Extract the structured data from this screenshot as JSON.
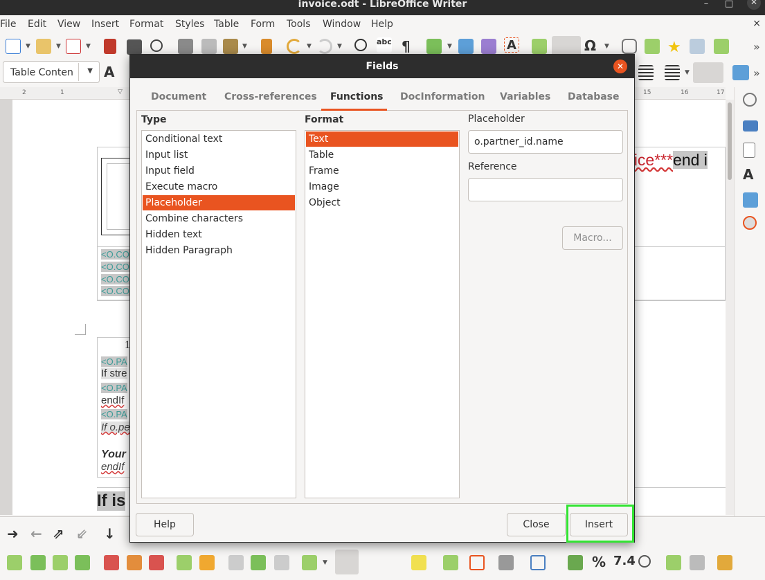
{
  "window": {
    "title": "invoice.odt - LibreOffice Writer"
  },
  "menubar": {
    "items": [
      "File",
      "Edit",
      "View",
      "Insert",
      "Format",
      "Styles",
      "Table",
      "Form",
      "Tools",
      "Window",
      "Help"
    ],
    "close_glyph": "×"
  },
  "toolbar": {
    "paragraph_style": "Table Conten",
    "more_glyph": "»"
  },
  "ruler": {
    "ticks": [
      "2",
      "1",
      "15",
      "16",
      "17"
    ]
  },
  "document": {
    "fragments": {
      "fld1": "<O.CO",
      "fld2": "<O.CO",
      "fld3": "<O.CO",
      "fld4": "<O.CO",
      "num": "1",
      "fld5": "<O.PA",
      "if_stre": "If stre",
      "fld6": "<O.PA",
      "endif1": "endIf",
      "fld7": "<O.PA",
      "if_o": "If o.pe",
      "your": "Your",
      "endif2": "endIf",
      "if_is": "If is",
      "invoice": "oice***",
      "end_if": "end i"
    }
  },
  "dialog": {
    "title": "Fields",
    "tabs": [
      "Document",
      "Cross-references",
      "Functions",
      "DocInformation",
      "Variables",
      "Database"
    ],
    "active_tab": "Functions",
    "type_label": "Type",
    "type_items": [
      "Conditional text",
      "Input list",
      "Input field",
      "Execute macro",
      "Placeholder",
      "Combine characters",
      "Hidden text",
      "Hidden Paragraph"
    ],
    "type_selected": "Placeholder",
    "format_label": "Format",
    "format_items": [
      "Text",
      "Table",
      "Frame",
      "Image",
      "Object"
    ],
    "format_selected": "Text",
    "placeholder_label": "Placeholder",
    "placeholder_value": "o.partner_id.name",
    "reference_label": "Reference",
    "reference_value": "",
    "macro_button": "Macro...",
    "help_button": "Help",
    "close_button": "Close",
    "insert_button": "Insert"
  },
  "bottom_toolbar": {
    "percent": "%",
    "number_format": "7.4"
  },
  "colors": {
    "accent": "#e95420",
    "highlight": "#32e332",
    "titlebar": "#2d2d2d"
  }
}
